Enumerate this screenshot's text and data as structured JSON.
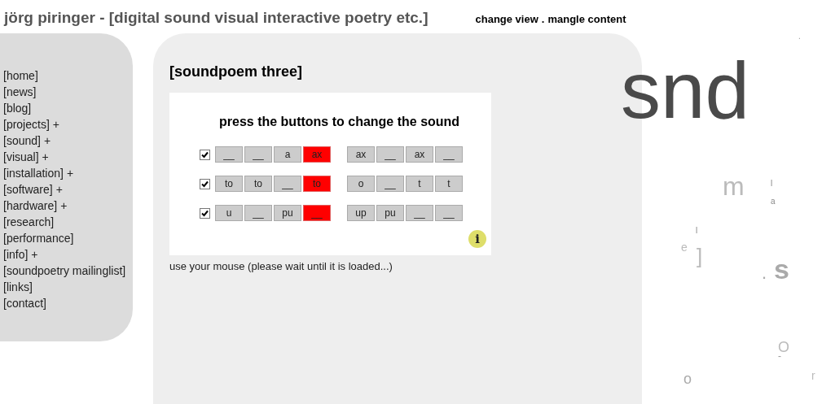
{
  "header": {
    "title": "jörg piringer - [digital sound visual interactive poetry etc.]",
    "links": [
      "change view",
      ". ",
      "mangle content"
    ]
  },
  "sidebar": {
    "items": [
      {
        "label": "[home]"
      },
      {
        "label": "[news]"
      },
      {
        "label": "[blog]"
      },
      {
        "label": "[projects]",
        "plus": "+"
      },
      {
        "label": "[sound]",
        "plus": "+"
      },
      {
        "label": "[visual]",
        "plus": "+"
      },
      {
        "label": "[installation]",
        "plus": "+"
      },
      {
        "label": "[software]",
        "plus": "+"
      },
      {
        "label": "[hardware]",
        "plus": "+"
      },
      {
        "label": "[research]"
      },
      {
        "label": "[performance]"
      },
      {
        "label": "[info]",
        "plus": "+"
      },
      {
        "label": "[soundpoetry mailinglist]"
      },
      {
        "label": "[links]"
      },
      {
        "label": "[contact]"
      }
    ]
  },
  "content": {
    "heading": "[soundpoem three]",
    "applet": {
      "instruction": "press the buttons to change the sound",
      "rows": [
        {
          "checked": true,
          "buttons": [
            {
              "label": "__",
              "on": false
            },
            {
              "label": "__",
              "on": false
            },
            {
              "label": "a",
              "on": false
            },
            {
              "label": "ax",
              "on": true
            },
            {
              "label": "ax",
              "on": false
            },
            {
              "label": "__",
              "on": false
            },
            {
              "label": "ax",
              "on": false
            },
            {
              "label": "__",
              "on": false
            }
          ]
        },
        {
          "checked": true,
          "buttons": [
            {
              "label": "to",
              "on": false
            },
            {
              "label": "to",
              "on": false
            },
            {
              "label": "__",
              "on": false
            },
            {
              "label": "to",
              "on": true
            },
            {
              "label": "o",
              "on": false
            },
            {
              "label": "__",
              "on": false
            },
            {
              "label": "t",
              "on": false
            },
            {
              "label": "t",
              "on": false
            }
          ]
        },
        {
          "checked": true,
          "buttons": [
            {
              "label": "u",
              "on": false
            },
            {
              "label": "__",
              "on": false
            },
            {
              "label": "pu",
              "on": false
            },
            {
              "label": "__",
              "on": true
            },
            {
              "label": "up",
              "on": false
            },
            {
              "label": "pu",
              "on": false
            },
            {
              "label": "__",
              "on": false
            },
            {
              "label": "__",
              "on": false
            }
          ]
        }
      ],
      "info": "i"
    },
    "note": "use your mouse (please wait until it is loaded...)"
  },
  "letters": [
    {
      "text": "."
    },
    {
      "text": "snd"
    },
    {
      "text": "m"
    },
    {
      "text": "l"
    },
    {
      "text": "a"
    },
    {
      "text": "l"
    },
    {
      "text": "e"
    },
    {
      "text": "]"
    },
    {
      "text": "."
    },
    {
      "text": "s"
    },
    {
      "text": "O"
    },
    {
      "text": "-"
    },
    {
      "text": "o"
    },
    {
      "text": "r"
    }
  ]
}
